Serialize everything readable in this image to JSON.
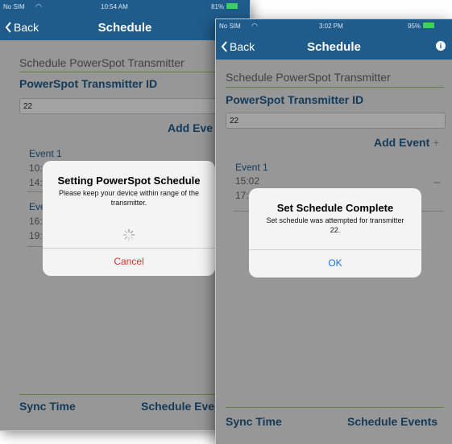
{
  "left_screen": {
    "status": {
      "carrier": "No SIM",
      "time": "10:54 AM",
      "battery": "81%"
    },
    "nav": {
      "back": "Back",
      "title": "Schedule"
    },
    "section_title": "Schedule PowerSpot Transmitter",
    "id_label": "PowerSpot Transmitter ID",
    "id_value": "22",
    "add_event": "Add Eve",
    "events": [
      {
        "title": "Event 1",
        "times": [
          "10:",
          "14:"
        ]
      },
      {
        "title": "Eve",
        "times": [
          "16:",
          "19:"
        ]
      }
    ],
    "bottom": {
      "sync_time": "Sync Time",
      "schedule_events": "Schedule Eve"
    },
    "alert": {
      "title": "Setting PowerSpot Schedule",
      "message": "Please keep your device within range of the transmitter.",
      "button": "Cancel"
    }
  },
  "right_screen": {
    "status": {
      "carrier": "No SIM",
      "time": "3:02 PM",
      "battery": "95%"
    },
    "nav": {
      "back": "Back",
      "title": "Schedule"
    },
    "section_title": "Schedule PowerSpot Transmitter",
    "id_label": "PowerSpot Transmitter ID",
    "id_value": "22",
    "add_event": "Add Event",
    "add_symbol": "+",
    "events": [
      {
        "title": "Event 1",
        "times": [
          "15:02",
          "17:"
        ],
        "remove_symbol": "–"
      }
    ],
    "bottom": {
      "sync_time": "Sync Time",
      "schedule_events": "Schedule Events"
    },
    "alert": {
      "title": "Set Schedule Complete",
      "message": "Set schedule was attempted for transmitter 22.",
      "button": "OK"
    }
  },
  "colors": {
    "nav_bar": "#1f5c8c",
    "accent_line": "#9ccf5b",
    "destructive": "#d9302b",
    "link": "#1a73e8"
  }
}
